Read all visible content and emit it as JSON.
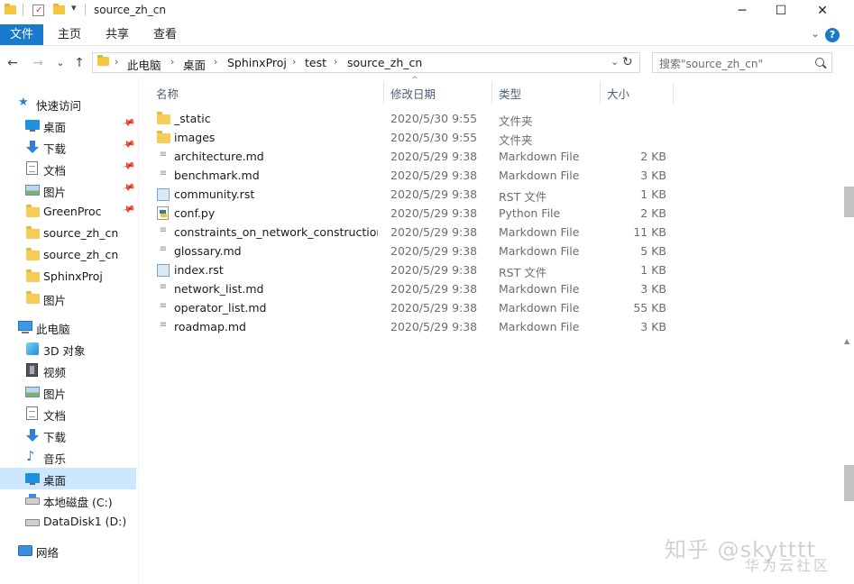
{
  "titlebar": {
    "title": "source_zh_cn",
    "minimize": "─",
    "maximize": "☐",
    "close": "✕",
    "dropdown": "▾"
  },
  "ribbon": {
    "tabs": [
      "文件",
      "主页",
      "共享",
      "查看"
    ],
    "collapse": "⌄",
    "help": "?"
  },
  "nav": {
    "back": "←",
    "forward": "→",
    "recent": "⌄",
    "up": "↑",
    "breadcrumb": [
      "此电脑",
      "桌面",
      "SphinxProj",
      "test",
      "source_zh_cn"
    ],
    "crumb_sep": "›",
    "addr_dropdown": "⌄",
    "refresh": "↻",
    "search_placeholder": "搜索\"source_zh_cn\""
  },
  "sidebar": {
    "quick_access": {
      "label": "快速访问",
      "items": [
        {
          "label": "桌面",
          "icon": "desktop-icon",
          "pinned": true
        },
        {
          "label": "下载",
          "icon": "download-icon",
          "pinned": true
        },
        {
          "label": "文档",
          "icon": "document-icon",
          "pinned": true
        },
        {
          "label": "图片",
          "icon": "picture-icon",
          "pinned": true
        },
        {
          "label": "GreenProc",
          "icon": "folder-icon",
          "pinned": true
        },
        {
          "label": "source_zh_cn",
          "icon": "folder-icon",
          "pinned": false
        },
        {
          "label": "source_zh_cn",
          "icon": "folder-icon",
          "pinned": false
        },
        {
          "label": "SphinxProj",
          "icon": "folder-icon",
          "pinned": false
        },
        {
          "label": "图片",
          "icon": "folder-icon",
          "pinned": false
        }
      ]
    },
    "this_pc": {
      "label": "此电脑",
      "items": [
        {
          "label": "3D 对象",
          "icon": "3d-objects-icon"
        },
        {
          "label": "视频",
          "icon": "video-icon"
        },
        {
          "label": "图片",
          "icon": "picture-icon"
        },
        {
          "label": "文档",
          "icon": "document-icon"
        },
        {
          "label": "下载",
          "icon": "download-icon"
        },
        {
          "label": "音乐",
          "icon": "music-icon"
        },
        {
          "label": "桌面",
          "icon": "desktop-icon",
          "selected": true
        },
        {
          "label": "本地磁盘 (C:)",
          "icon": "drive-icon"
        },
        {
          "label": "DataDisk1 (D:)",
          "icon": "drive-icon"
        }
      ]
    },
    "network": {
      "label": "网络",
      "icon": "network-icon"
    }
  },
  "columns": {
    "name": "名称",
    "date": "修改日期",
    "type": "类型",
    "size": "大小",
    "sort_indicator": "^"
  },
  "files": [
    {
      "name": "_static",
      "date": "2020/5/30 9:55",
      "type": "文件夹",
      "size": "",
      "icon": "folder"
    },
    {
      "name": "images",
      "date": "2020/5/30 9:55",
      "type": "文件夹",
      "size": "",
      "icon": "folder"
    },
    {
      "name": "architecture.md",
      "date": "2020/5/29 9:38",
      "type": "Markdown File",
      "size": "2 KB",
      "icon": "md"
    },
    {
      "name": "benchmark.md",
      "date": "2020/5/29 9:38",
      "type": "Markdown File",
      "size": "3 KB",
      "icon": "md"
    },
    {
      "name": "community.rst",
      "date": "2020/5/29 9:38",
      "type": "RST 文件",
      "size": "1 KB",
      "icon": "rst"
    },
    {
      "name": "conf.py",
      "date": "2020/5/29 9:38",
      "type": "Python File",
      "size": "2 KB",
      "icon": "py"
    },
    {
      "name": "constraints_on_network_construction....",
      "date": "2020/5/29 9:38",
      "type": "Markdown File",
      "size": "11 KB",
      "icon": "md"
    },
    {
      "name": "glossary.md",
      "date": "2020/5/29 9:38",
      "type": "Markdown File",
      "size": "5 KB",
      "icon": "md"
    },
    {
      "name": "index.rst",
      "date": "2020/5/29 9:38",
      "type": "RST 文件",
      "size": "1 KB",
      "icon": "rst"
    },
    {
      "name": "network_list.md",
      "date": "2020/5/29 9:38",
      "type": "Markdown File",
      "size": "3 KB",
      "icon": "md"
    },
    {
      "name": "operator_list.md",
      "date": "2020/5/29 9:38",
      "type": "Markdown File",
      "size": "55 KB",
      "icon": "md"
    },
    {
      "name": "roadmap.md",
      "date": "2020/5/29 9:38",
      "type": "Markdown File",
      "size": "3 KB",
      "icon": "md"
    }
  ],
  "watermark": {
    "line1": "知乎 @skytttt",
    "line2": "华为云社区"
  },
  "colors": {
    "accent": "#1979ca",
    "selected": "#cce8ff",
    "folder": "#f7cd5a"
  }
}
